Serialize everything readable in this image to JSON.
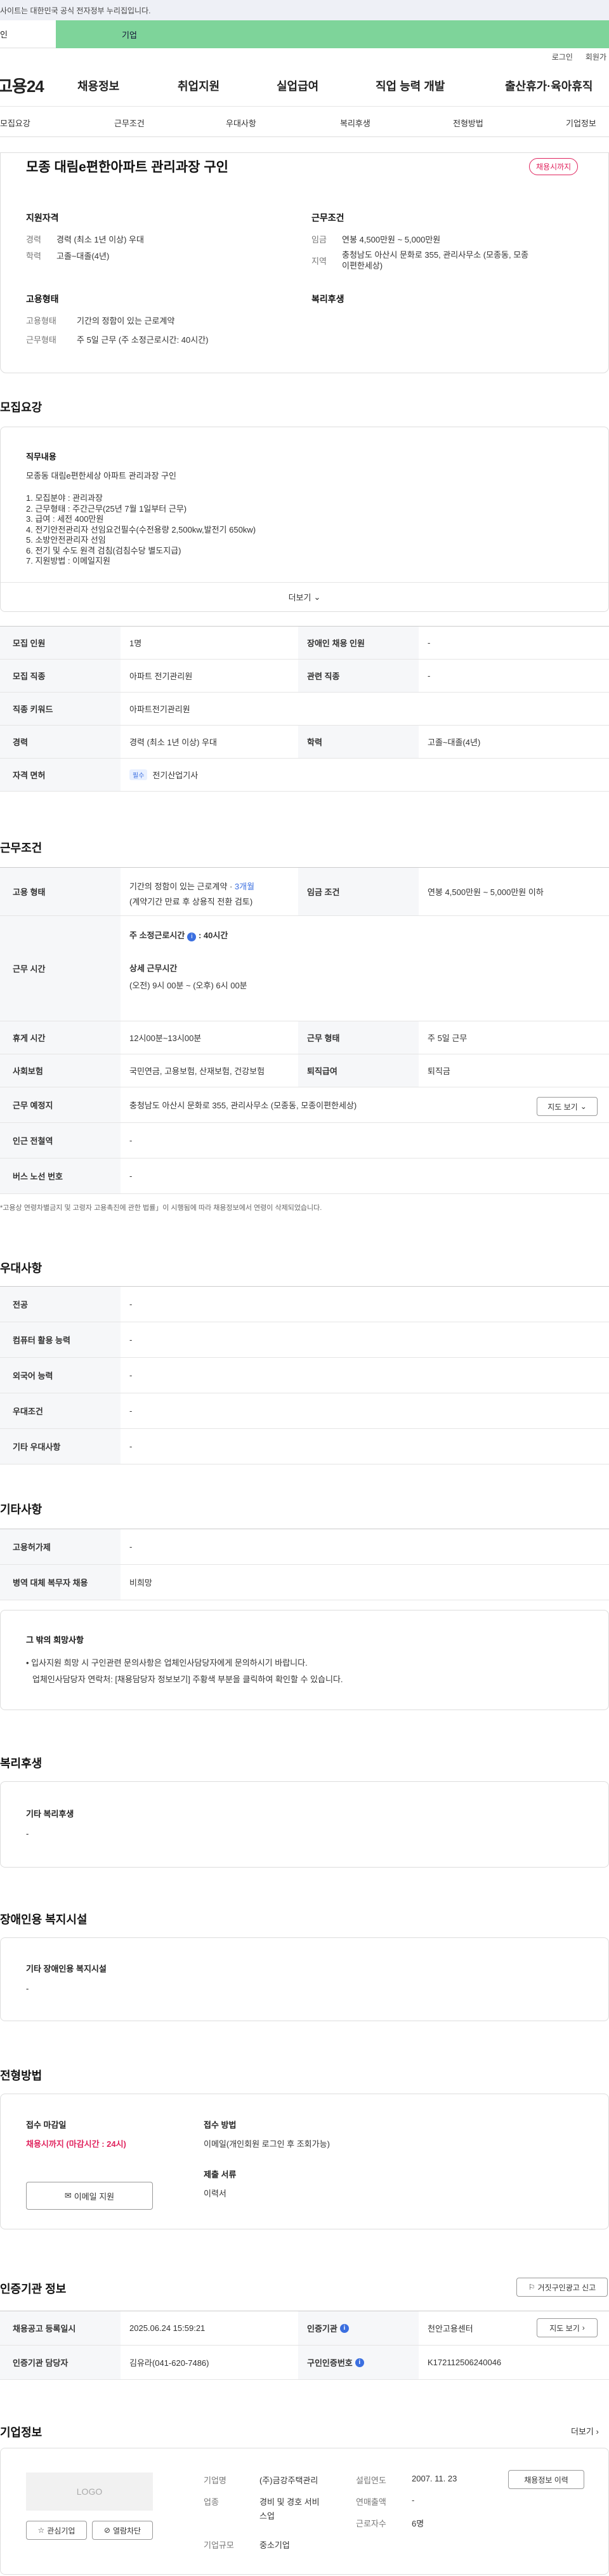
{
  "gov_bar": {
    "text": "사이트는 대한민국 공식 전자정부 누리집입니다."
  },
  "site_tabs": {
    "tab1": "인",
    "tab2": "기업"
  },
  "util": {
    "login": "로그인",
    "join": "회원가"
  },
  "gnb": {
    "logo": "고용24",
    "menu": [
      "채용정보",
      "취업지원",
      "실업급여",
      "직업 능력 개발",
      "출산휴가·육아휴직"
    ]
  },
  "subnav": [
    "모집요강",
    "근무조건",
    "우대사항",
    "복리후생",
    "전형방법",
    "기업정보"
  ],
  "summary": {
    "title": "모종 대림e편한아파트 관리과장 구인",
    "status": "채용시까지",
    "qual_h": "지원자격",
    "career_k": "경력",
    "career_v": "경력 (최소 1년 이상) 우대",
    "edu_k": "학력",
    "edu_v": "고졸~대졸(4년)",
    "cond_h": "근무조건",
    "wage_k": "임금",
    "wage_v": "연봉 4,500만원 ~ 5,000만원",
    "region_k": "지역",
    "region_v1": "충청남도 아산시 문화로 355, 관리사무소 (모종동, 모종",
    "region_v2": "이편한세상)",
    "emp_h": "고용형태",
    "emptype_k": "고용형태",
    "emptype_v": "기간의 정함이 있는 근로계약",
    "worktype_k": "근무형태",
    "worktype_v": "주 5일 근무 (주 소정근로시간: 40시간)",
    "welfare_h": "복리후생"
  },
  "recruit": {
    "section": "모집요강",
    "job_h": "직무내용",
    "job_line0": "모종동 대림e편한세상 아파트 관리과장 구인",
    "job_lines": [
      "1. 모집분야 : 관리과장",
      "2. 근무형태 : 주간근무(25년 7월 1일부터 근무)",
      "3. 급여 : 세전 400만원",
      "4. 전기안전관리자 선임요건필수(수전용량 2,500kw,발전기 650kw)",
      "5. 소방안전관리자 선임",
      "6. 전기 및 수도 원격 검침(검침수당 별도지급)",
      "7. 지원방법 : 이메일지원"
    ],
    "more": "더보기",
    "rows": [
      {
        "k1": "모집 인원",
        "v1": "1명",
        "k2": "장애인 채용 인원",
        "v2": "-"
      },
      {
        "k1": "모집 직종",
        "v1": "아파트 전기관리원",
        "k2": "관련 직종",
        "v2": "-"
      },
      {
        "k1": "직종 키워드",
        "v1": "아파트전기관리원"
      },
      {
        "k1": "경력",
        "v1": "경력 (최소 1년 이상) 우대",
        "k2": "학력",
        "v2": "고졸~대졸(4년)"
      },
      {
        "k1": "자격 면허",
        "pill": "필수",
        "v1": "전기산업기사"
      }
    ]
  },
  "work": {
    "section": "근무조건",
    "emp_k": "고용 형태",
    "emp_v1": "기간의 정함이 있는 근로계약 · ",
    "emp_v1b": "3개월",
    "emp_v2": "(계약기간 만료 후 상용직 전환 검토)",
    "wage_k": "임금 조건",
    "wage_v": "연봉 4,500만원 ~ 5,000만원 이하",
    "time_k": "근무 시간",
    "time_h1": "주 소정근로시간",
    "time_v1": ": 40시간",
    "time_h2": "상세 근무시간",
    "time_v2": "(오전) 9시 00분 ~ (오후) 6시 00분",
    "rest_k": "휴게 시간",
    "rest_v": "12시00분~13시00분",
    "form_k": "근무 형태",
    "form_v": "주 5일 근무",
    "ins_k": "사회보험",
    "ins_v": "국민연금, 고용보험, 산재보험, 건강보험",
    "sev_k": "퇴직급여",
    "sev_v": "퇴직금",
    "place_k": "근무 예정지",
    "place_v": "충청남도 아산시 문화로 355, 관리사무소 (모종동, 모종이편한세상)",
    "map_btn": "지도 보기",
    "sub_k": "인근 전철역",
    "sub_v": "-",
    "bus_k": "버스 노선 번호",
    "bus_v": "-",
    "note": "*고용상 연령차별금지 및 고령자 고용촉진에 관한 법률」이 시행됨에 따라 채용정보에서 연령이 삭제되었습니다."
  },
  "pref": {
    "section": "우대사항",
    "rows": [
      {
        "k": "전공",
        "v": "-"
      },
      {
        "k": "컴퓨터 활용 능력",
        "v": "-"
      },
      {
        "k": "외국어 능력",
        "v": "-"
      },
      {
        "k": "우대조건",
        "v": "-"
      },
      {
        "k": "기타 우대사항",
        "v": "-"
      }
    ]
  },
  "etc": {
    "section": "기타사항",
    "rows": [
      {
        "k": "고용허가제",
        "v": "-"
      },
      {
        "k": "병역 대체 복무자 채용",
        "v": "비희망"
      }
    ],
    "hope_h": "그 밖의 희망사항",
    "hope_1": "• 입사지원 희망 시 구인관련 문의사항은 업체인사담당자에게 문의하시기 바랍니다.",
    "hope_2": "업체인사담당자 연락처: [채용담당자 정보보기] 주황색 부분을 클릭하여 확인할 수 있습니다."
  },
  "welfare": {
    "section": "복리후생",
    "h": "기타 복리후생",
    "v": "-"
  },
  "disabled": {
    "section": "장애인용 복지시설",
    "h": "기타 장애인용 복지시설",
    "v": "-"
  },
  "screening": {
    "section": "전형방법",
    "deadline_h": "접수 마감일",
    "deadline_v": "채용시까지 (마감시간 : 24시)",
    "email_btn": "이메일 지원",
    "method_h": "접수 방법",
    "method_v": "이메일(개인회원 로그인 후 조회가능)",
    "docs_h": "제출 서류",
    "docs_v": "이력서"
  },
  "cert": {
    "section": "인증기관 정보",
    "report_btn": "거짓구인광고 신고",
    "r1k1": "채용공고 등록일시",
    "r1v1": "2025.06.24 15:59:21",
    "r1k2": "인증기관",
    "r1v2": "천안고용센터",
    "map_btn": "지도 보기",
    "r2k1": "인증기관 담당자",
    "r2v1": "김유라(041-620-7486)",
    "r2k2": "구인인증번호",
    "r2v2": "K172112506240046"
  },
  "company": {
    "section": "기업정보",
    "more": "더보기",
    "logo": "LOGO",
    "fav_btn": "관심기업",
    "block_btn": "열람차단",
    "name_k": "기업명",
    "name_v": "(주)금강주택관리",
    "industry_k": "업종",
    "industry_v1": "경비 및 경호 서비",
    "industry_v2": "스업",
    "size_k": "기업규모",
    "size_v": "중소기업",
    "founded_k": "설립연도",
    "founded_v": "2007. 11. 23",
    "revenue_k": "연매출액",
    "revenue_v": "-",
    "staff_k": "근로자수",
    "staff_v": "6명",
    "jobs_btn": "채용정보 이력"
  }
}
